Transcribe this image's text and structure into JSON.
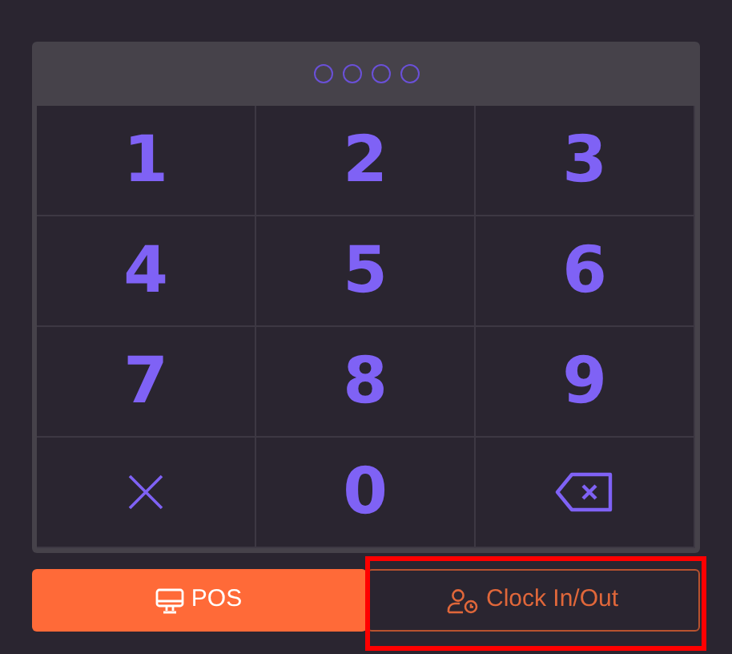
{
  "pin_dots": [
    {
      "filled": false
    },
    {
      "filled": false
    },
    {
      "filled": false
    },
    {
      "filled": false
    }
  ],
  "keys": [
    {
      "kind": "digit",
      "label": "1"
    },
    {
      "kind": "digit",
      "label": "2"
    },
    {
      "kind": "digit",
      "label": "3"
    },
    {
      "kind": "digit",
      "label": "4"
    },
    {
      "kind": "digit",
      "label": "5"
    },
    {
      "kind": "digit",
      "label": "6"
    },
    {
      "kind": "digit",
      "label": "7"
    },
    {
      "kind": "digit",
      "label": "8"
    },
    {
      "kind": "digit",
      "label": "9"
    },
    {
      "kind": "clear"
    },
    {
      "kind": "digit",
      "label": "0"
    },
    {
      "kind": "backspace"
    }
  ],
  "modes": [
    {
      "kind": "pos",
      "label": "POS",
      "selected": true,
      "highlighted": false
    },
    {
      "kind": "clock",
      "label": "Clock In/Out",
      "selected": false,
      "highlighted": true
    }
  ]
}
